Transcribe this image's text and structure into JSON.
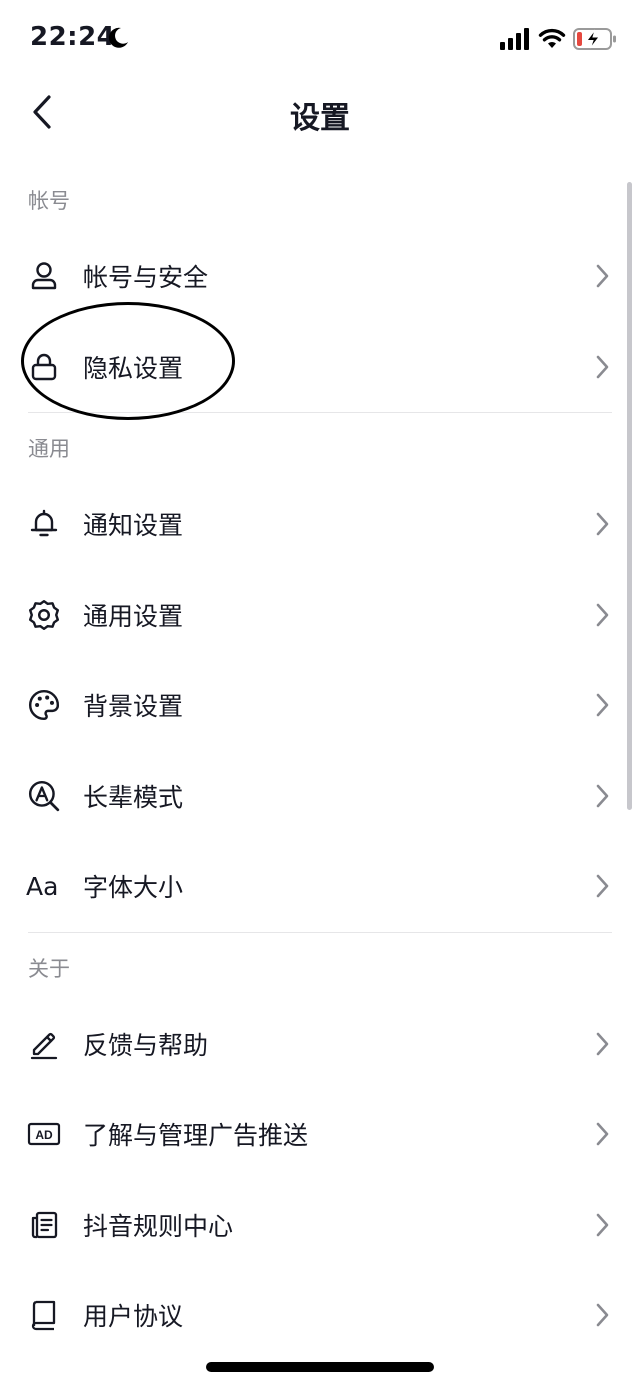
{
  "status_bar": {
    "time": "22:24",
    "icons": [
      "moon-icon",
      "signal-icon",
      "wifi-icon",
      "battery-icon"
    ]
  },
  "nav": {
    "title": "设置",
    "back_icon": "back-arrow-icon"
  },
  "sections": [
    {
      "title": "帐号",
      "items": [
        {
          "label": "帐号与安全",
          "icon": "user-icon"
        },
        {
          "label": "隐私设置",
          "icon": "lock-icon"
        }
      ]
    },
    {
      "title": "通用",
      "items": [
        {
          "label": "通知设置",
          "icon": "bell-icon"
        },
        {
          "label": "通用设置",
          "icon": "gear-icon"
        },
        {
          "label": "背景设置",
          "icon": "palette-icon"
        },
        {
          "label": "长辈模式",
          "icon": "elder-mode-icon"
        },
        {
          "label": "字体大小",
          "icon": "font-size-icon",
          "icon_text": "Aa"
        }
      ]
    },
    {
      "title": "关于",
      "items": [
        {
          "label": "反馈与帮助",
          "icon": "pencil-icon"
        },
        {
          "label": "了解与管理广告推送",
          "icon": "ad-icon",
          "icon_text": "AD"
        },
        {
          "label": "抖音规则中心",
          "icon": "document-icon"
        },
        {
          "label": "用户协议",
          "icon": "book-icon"
        }
      ]
    }
  ],
  "colors": {
    "text": "#161823",
    "section_header": "#8a8b91",
    "divider": "#e6e6e8",
    "battery_low": "#e5483f"
  }
}
